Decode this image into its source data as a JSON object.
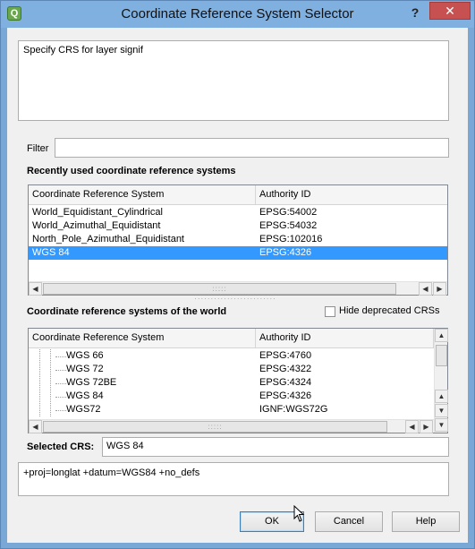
{
  "window": {
    "title": "Coordinate Reference System Selector",
    "help_glyph": "?",
    "close_glyph": "✕",
    "app_icon_glyph": "Q"
  },
  "message": "Specify CRS for layer signif",
  "filter": {
    "label": "Filter",
    "value": ""
  },
  "recent": {
    "heading": "Recently used coordinate reference systems",
    "columns": [
      "Coordinate Reference System",
      "Authority ID"
    ],
    "rows": [
      {
        "name": "World_Equidistant_Cylindrical",
        "id": "EPSG:54002"
      },
      {
        "name": "World_Azimuthal_Equidistant",
        "id": "EPSG:54032"
      },
      {
        "name": "North_Pole_Azimuthal_Equidistant",
        "id": "EPSG:102016"
      },
      {
        "name": "WGS 84",
        "id": "EPSG:4326"
      }
    ],
    "selected_index": 3
  },
  "world": {
    "heading": "Coordinate reference systems of the world",
    "hide_deprecated_label": "Hide deprecated CRSs",
    "hide_deprecated_checked": false,
    "columns": [
      "Coordinate Reference System",
      "Authority ID"
    ],
    "rows": [
      {
        "name": "WGS 66",
        "id": "EPSG:4760"
      },
      {
        "name": "WGS 72",
        "id": "EPSG:4322"
      },
      {
        "name": "WGS 72BE",
        "id": "EPSG:4324"
      },
      {
        "name": "WGS 84",
        "id": "EPSG:4326"
      },
      {
        "name": "WGS72",
        "id": "IGNF:WGS72G"
      }
    ]
  },
  "selected_crs": {
    "label": "Selected CRS:",
    "value": "WGS 84",
    "proj": "+proj=longlat +datum=WGS84 +no_defs"
  },
  "buttons": {
    "ok": "OK",
    "cancel": "Cancel",
    "help": "Help"
  },
  "colors": {
    "selection": "#3399ff",
    "titlebar": "#7fb0e0",
    "close": "#c75050"
  }
}
